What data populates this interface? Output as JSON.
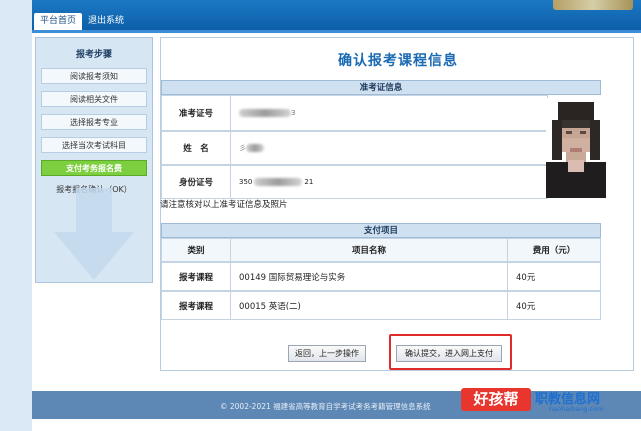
{
  "nav": {
    "tabs": [
      {
        "label": "平台首页"
      },
      {
        "label": "退出系统"
      }
    ]
  },
  "sidebar": {
    "title": "报考步骤",
    "steps": [
      {
        "label": "阅读报考须知"
      },
      {
        "label": "阅读相关文件"
      },
      {
        "label": "选择报考专业"
      },
      {
        "label": "选择当次考试科目"
      },
      {
        "label": "支付考务报名费",
        "active": true
      },
      {
        "label": "报考报名确认（OK）"
      }
    ]
  },
  "main": {
    "title": "确认报考课程信息",
    "ticket": {
      "header": "准考证信息",
      "rows": [
        {
          "label": "准考证号",
          "value": "3"
        },
        {
          "label": "姓　名",
          "value": "彡"
        },
        {
          "label": "身份证号",
          "value_left": "350",
          "value_right": "21"
        }
      ]
    },
    "note": "请注意核对以上准考证信息及照片",
    "payment": {
      "header": "支付项目",
      "columns": [
        "类别",
        "项目名称",
        "费用（元）"
      ],
      "rows": [
        {
          "category": "报考课程",
          "name": "00149 国际贸易理论与实务",
          "fee": "40元"
        },
        {
          "category": "报考课程",
          "name": "00015 英语(二)",
          "fee": "40元"
        }
      ]
    },
    "buttons": {
      "back": "返回，上一步操作",
      "submit": "确认提交，进入网上支付"
    }
  },
  "footer": {
    "copyright": "© 2002-2021 福建省高等教育自学考试考务考籍管理信息系统"
  },
  "watermark": {
    "badge": "好孩帮",
    "brand": "职教信息网",
    "url": "haohaibang.com"
  },
  "colors": {
    "accent": "#1a6ab4",
    "active_step": "#7ccf3f",
    "highlight": "#e02b2b"
  }
}
